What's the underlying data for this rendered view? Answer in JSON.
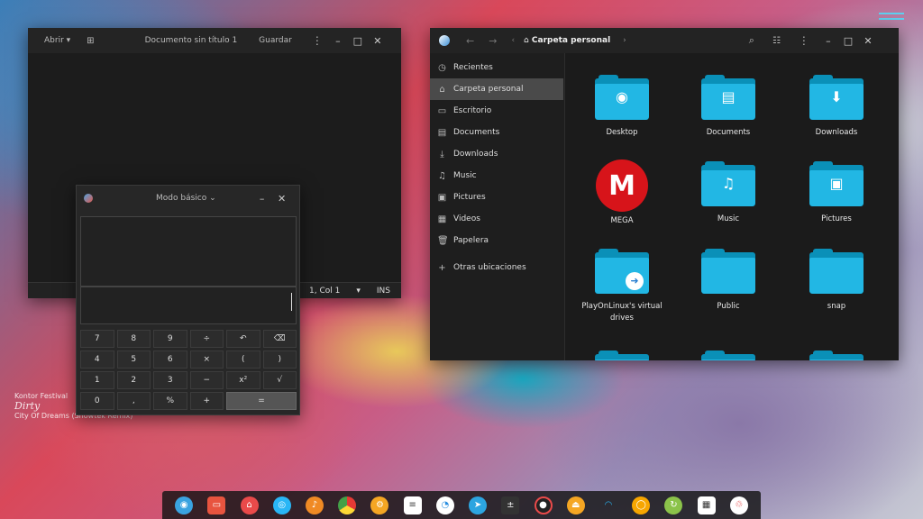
{
  "gedit": {
    "open_label": "Abrir",
    "title": "Documento sin título 1",
    "save_label": "Guardar",
    "position": "1, Col 1",
    "mode": "INS"
  },
  "calculator": {
    "mode_label": "Modo básico",
    "keys": [
      [
        "7",
        "8",
        "9",
        "÷",
        "↶",
        "⌫"
      ],
      [
        "4",
        "5",
        "6",
        "×",
        "(",
        ")"
      ],
      [
        "1",
        "2",
        "3",
        "−",
        "x²",
        "√"
      ],
      [
        "0",
        ",",
        "%",
        "+",
        "="
      ]
    ]
  },
  "files": {
    "title": "Carpeta personal",
    "sidebar": [
      {
        "label": "Recientes",
        "icon": "clock-icon"
      },
      {
        "label": "Carpeta personal",
        "icon": "home-icon"
      },
      {
        "label": "Escritorio",
        "icon": "desktop-icon"
      },
      {
        "label": "Documents",
        "icon": "document-icon"
      },
      {
        "label": "Downloads",
        "icon": "download-icon"
      },
      {
        "label": "Music",
        "icon": "music-icon"
      },
      {
        "label": "Pictures",
        "icon": "picture-icon"
      },
      {
        "label": "Videos",
        "icon": "video-icon"
      },
      {
        "label": "Papelera",
        "icon": "trash-icon"
      },
      {
        "label": "Otras ubicaciones",
        "icon": "plus-icon"
      }
    ],
    "items": [
      {
        "label": "Desktop"
      },
      {
        "label": "Documents"
      },
      {
        "label": "Downloads"
      },
      {
        "label": "MEGA"
      },
      {
        "label": "Music"
      },
      {
        "label": "Pictures"
      },
      {
        "label": "PlayOnLinux's virtual drives"
      },
      {
        "label": "Public"
      },
      {
        "label": "snap"
      }
    ]
  },
  "wallpaper_text": {
    "line1": "Kontor Festival",
    "line2": "Dirty",
    "line3": "City Of Dreams (Showtek Remix)"
  },
  "colors": {
    "folder": "#22b7e4",
    "selection": "#4a4a4a",
    "mega": "#d7141a"
  }
}
